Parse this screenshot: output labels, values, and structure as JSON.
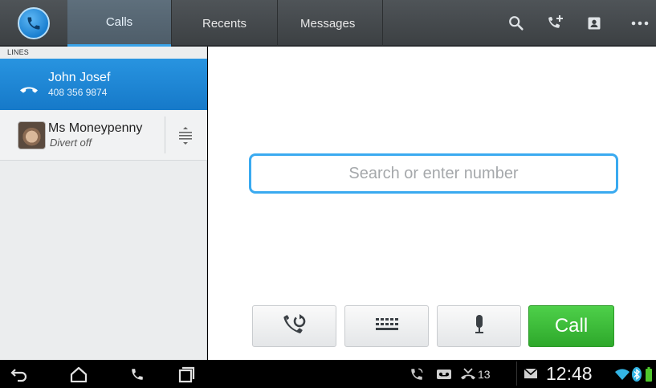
{
  "tabs": {
    "calls": "Calls",
    "recents": "Recents",
    "messages": "Messages"
  },
  "actions": [
    "search-icon",
    "add-call-icon",
    "contacts-icon",
    "overflow-menu-icon"
  ],
  "lines_panel": {
    "header": "LINES",
    "items": [
      {
        "name": "John Josef",
        "detail": "408 356 9874",
        "active": true
      },
      {
        "name": "Ms Moneypenny",
        "detail": "Divert off",
        "active": false
      }
    ]
  },
  "dialer": {
    "placeholder": "Search or enter number",
    "call_label": "Call"
  },
  "status_bar": {
    "notification_count": "13",
    "time": "12:48"
  },
  "colors": {
    "accent_blue": "#2894e0",
    "call_green": "#2ea82b",
    "topbar_dark": "#3c4043"
  }
}
